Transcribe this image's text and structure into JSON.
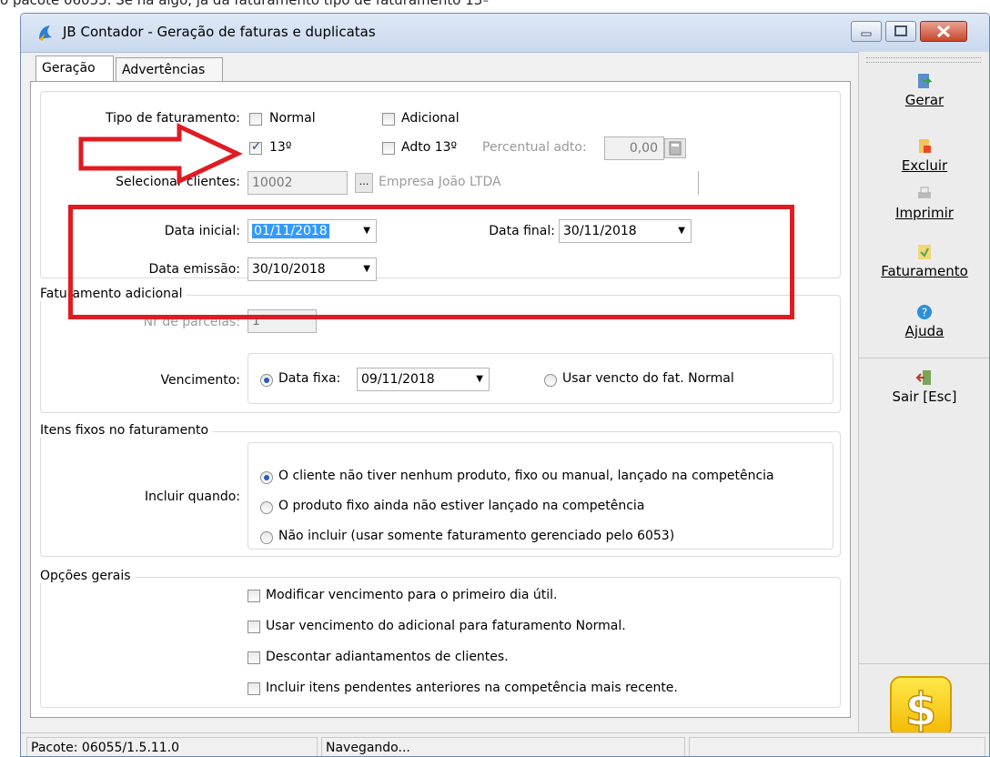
{
  "window": {
    "title": "JB Contador - Geração de faturas e duplicatas"
  },
  "tabs": [
    {
      "label": "Geração"
    },
    {
      "label": "Advertências"
    }
  ],
  "tipo": {
    "label": "Tipo de faturamento:",
    "normal": "Normal",
    "adicional": "Adicional",
    "decimo": "13º",
    "adto13": "Adto 13º",
    "percentual_label": "Percentual adto:",
    "percentual_value": "0,00"
  },
  "clientes": {
    "label": "Selecionar clientes:",
    "code": "10002",
    "name": "Empresa João LTDA"
  },
  "datas": {
    "inicial_label": "Data inicial:",
    "inicial_value": "01/11/2018",
    "final_label": "Data final:",
    "final_value": "30/11/2018",
    "emissao_label": "Data emissão:",
    "emissao_value": "30/10/2018"
  },
  "adicional": {
    "group_title": "Faturamento adicional",
    "parcelas_label": "Nr de parcelas:",
    "parcelas_value": "1",
    "vencimento_label": "Vencimento:",
    "data_fixa_label": "Data fixa:",
    "data_fixa_value": "09/11/2018",
    "usar_vencto": "Usar vencto do fat. Normal"
  },
  "itens": {
    "group_title": "Itens fixos no faturamento",
    "incluir_label": "Incluir quando:",
    "opt1": "O cliente não tiver nenhum produto, fixo ou manual, lançado na competência",
    "opt2": "O produto fixo ainda não estiver lançado na competência",
    "opt3": "Não incluir (usar somente faturamento gerenciado pelo 6053)"
  },
  "opcoes": {
    "group_title": "Opções gerais",
    "o1": "Modificar vencimento para o primeiro dia útil.",
    "o2": "Usar vencimento do adicional para faturamento Normal.",
    "o3": "Descontar adiantamentos de clientes.",
    "o4": "Incluir itens pendentes anteriores na competência mais recente."
  },
  "sidebar": {
    "gerar": "Gerar",
    "excluir": "Excluir",
    "imprimir": "Imprimir",
    "faturamento": "Faturamento",
    "ajuda": "Ajuda",
    "sair": "Sair [Esc]"
  },
  "status": {
    "pacote": "Pacote: 06055/1.5.11.0",
    "modo": "Navegando..."
  },
  "overlay_top_text": "o pacote 06055. Se há algo, ja dá faturamento tipo de faturamento 13º",
  "colors": {
    "highlight_red": "#e01b22",
    "selection_blue": "#3399ff"
  }
}
